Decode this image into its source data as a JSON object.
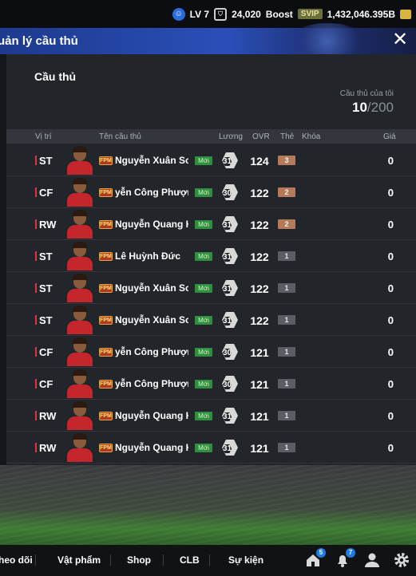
{
  "topbar": {
    "level": "LV 7",
    "coins": "24,020",
    "boost_label": "Boost",
    "svip_label": "SVIP",
    "bp": "1,432,046.395B"
  },
  "header": {
    "title": "uản lý cầu thủ"
  },
  "panel": {
    "section_title": "Cầu thủ",
    "my_players_label": "Cầu thủ của tôi",
    "my_players_count": "10",
    "my_players_max": "/200"
  },
  "columns": {
    "position": "Vị trí",
    "name": "Tên cầu thủ",
    "salary": "Lương",
    "ovr": "OVR",
    "grade": "Thẻ",
    "lock": "Khóa",
    "price": "Giá"
  },
  "players": [
    {
      "pos": "ST",
      "season": "FPM",
      "name": "Nguyễn Xuân Son",
      "new": "Mới",
      "salary": "31",
      "ovr": "124",
      "grade": "3",
      "price": "0"
    },
    {
      "pos": "CF",
      "season": "FPM",
      "name": "yễn Công Phượng",
      "new": "Mới",
      "salary": "30",
      "ovr": "122",
      "grade": "2",
      "price": "0"
    },
    {
      "pos": "RW",
      "season": "FPM",
      "name": "Nguyễn Quang Hả",
      "new": "Mới",
      "salary": "31",
      "ovr": "122",
      "grade": "2",
      "price": "0"
    },
    {
      "pos": "ST",
      "season": "FPM",
      "name": "Lê Huỳnh Đức",
      "new": "Mới",
      "salary": "31",
      "ovr": "122",
      "grade": "1",
      "price": "0"
    },
    {
      "pos": "ST",
      "season": "FPM",
      "name": "Nguyễn Xuân Son",
      "new": "Mới",
      "salary": "31",
      "ovr": "122",
      "grade": "1",
      "price": "0"
    },
    {
      "pos": "ST",
      "season": "FPM",
      "name": "Nguyễn Xuân Son",
      "new": "Mới",
      "salary": "31",
      "ovr": "122",
      "grade": "1",
      "price": "0"
    },
    {
      "pos": "CF",
      "season": "FPM",
      "name": "yễn Công Phượng",
      "new": "Mới",
      "salary": "30",
      "ovr": "121",
      "grade": "1",
      "price": "0"
    },
    {
      "pos": "CF",
      "season": "FPM",
      "name": "yễn Công Phượng",
      "new": "Mới",
      "salary": "30",
      "ovr": "121",
      "grade": "1",
      "price": "0"
    },
    {
      "pos": "RW",
      "season": "FPM",
      "name": "Nguyễn Quang Hả",
      "new": "Mới",
      "salary": "31",
      "ovr": "121",
      "grade": "1",
      "price": "0"
    },
    {
      "pos": "RW",
      "season": "FPM",
      "name": "Nguyễn Quang Hả",
      "new": "Mới",
      "salary": "31",
      "ovr": "121",
      "grade": "1",
      "price": "0"
    }
  ],
  "bottom_nav": {
    "items": [
      "heo dõi",
      "Vật phẩm",
      "Shop",
      "CLB",
      "Sự kiện"
    ],
    "home_badge": "5",
    "notify_badge": "7"
  },
  "colors": {
    "header_blue": "#2a4fb8",
    "position_red": "#e4323c",
    "new_badge_green": "#2f8f3c",
    "grade_bronze": "#b37a5c",
    "grade_gray": "#5a5e64"
  }
}
